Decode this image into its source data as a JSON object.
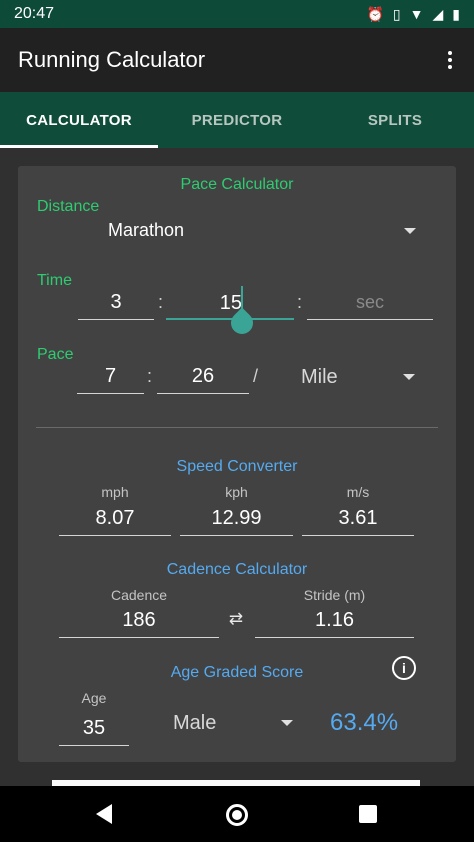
{
  "status_bar": {
    "time": "20:47",
    "icons": [
      "alarm-icon",
      "vibrate-icon",
      "wifi-icon",
      "signal-icon",
      "battery-icon"
    ]
  },
  "app_bar": {
    "title": "Running Calculator",
    "menu_icon": "more-vert-icon"
  },
  "tabs": [
    {
      "label": "CALCULATOR",
      "active": true
    },
    {
      "label": "PREDICTOR",
      "active": false
    },
    {
      "label": "SPLITS",
      "active": false
    }
  ],
  "pace_calculator": {
    "title": "Pace Calculator",
    "distance_label": "Distance",
    "distance_value": "Marathon",
    "time_label": "Time",
    "time_hours": "3",
    "time_sep": ":",
    "time_minutes": "15",
    "time_seconds_placeholder": "sec",
    "pace_label": "Pace",
    "pace_minutes": "7",
    "pace_sep": ":",
    "pace_seconds": "26",
    "pace_slash": "/",
    "pace_unit": "Mile"
  },
  "speed_converter": {
    "title": "Speed Converter",
    "mph_label": "mph",
    "mph_value": "8.07",
    "kph_label": "kph",
    "kph_value": "12.99",
    "ms_label": "m/s",
    "ms_value": "3.61"
  },
  "cadence_calculator": {
    "title": "Cadence Calculator",
    "cadence_label": "Cadence",
    "cadence_value": "186",
    "stride_label": "Stride (m)",
    "stride_value": "1.16",
    "swap_icon": "swap-icon"
  },
  "age_graded": {
    "title": "Age Graded Score",
    "info_icon": "info-icon",
    "age_label": "Age",
    "age_value": "35",
    "gender_value": "Male",
    "score": "63.4%"
  },
  "colors": {
    "accent_green": "#2ecc71",
    "accent_blue": "#55aaf0",
    "tab_bar": "#0f4c3a",
    "card": "#424242",
    "cursor_teal": "#3aa597"
  }
}
